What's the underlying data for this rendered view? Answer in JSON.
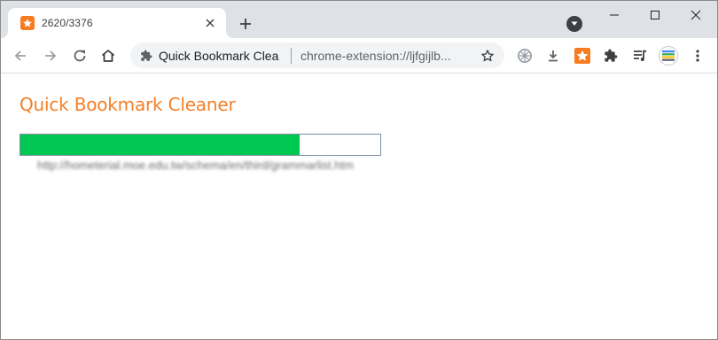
{
  "tab": {
    "title": "2620/3376",
    "favicon_icon": "star-icon",
    "favicon_color": "#f57c20"
  },
  "omnibox": {
    "site_name": "Quick Bookmark Clea",
    "url": "chrome-extension://ljfgijlb..."
  },
  "page": {
    "title": "Quick Bookmark Cleaner",
    "title_color": "#f47f27",
    "progress": {
      "done": 2620,
      "total": 3376,
      "fraction": 0.776,
      "fill_color": "#00c853"
    },
    "current_url": "http://hometerial.moe.edu.tw/schema/en/third/grammarlist.htm"
  },
  "toolbar_icons": [
    "back-icon",
    "forward-icon",
    "reload-icon",
    "home-icon",
    "color-wheel-extension-icon",
    "download-icon",
    "quick-bookmark-cleaner-extension-icon",
    "extensions-puzzle-icon",
    "media-queue-icon",
    "profile-avatar-icon",
    "menu-kebab-icon"
  ]
}
